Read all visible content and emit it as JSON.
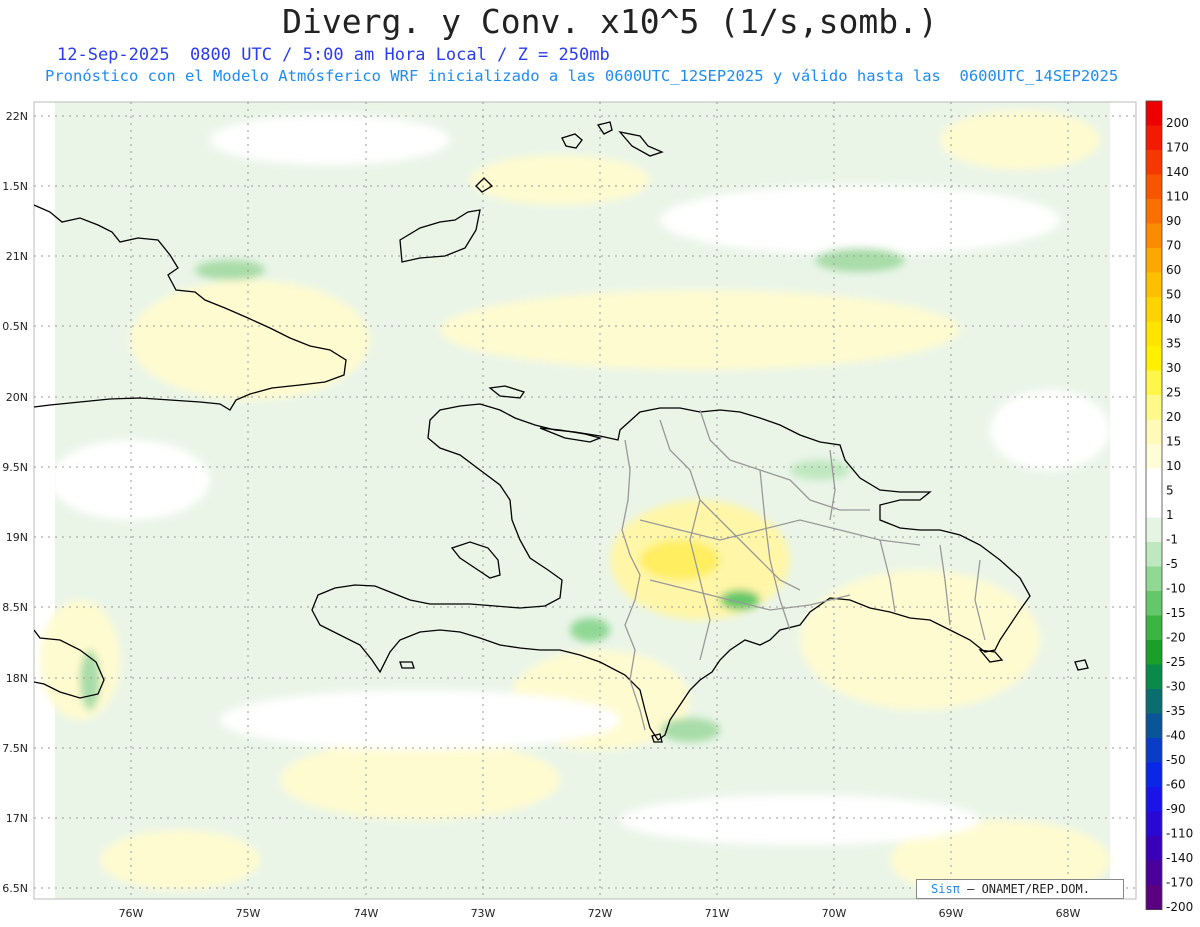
{
  "header": {
    "title": "Diverg. y Conv. x10^5 (1/s,somb.)",
    "subtitle": "12-Sep-2025  0800 UTC / 5:00 am Hora Local / Z = 250mb",
    "info": "Pronóstico con el Modelo Atmósferico WRF inicializado a las 0600UTC_12SEP2025 y válido hasta las  0600UTC_14SEP2025"
  },
  "map": {
    "lat_labels": [
      "22N",
      "1.5N",
      "21N",
      "0.5N",
      "20N",
      "9.5N",
      "19N",
      "8.5N",
      "18N",
      "7.5N",
      "17N",
      "6.5N"
    ],
    "lon_labels": [
      "76W",
      "75W",
      "74W",
      "73W",
      "72W",
      "71W",
      "70W",
      "69W",
      "68W"
    ]
  },
  "colorbar": {
    "labels": [
      "200",
      "170",
      "140",
      "110",
      "90",
      "70",
      "60",
      "50",
      "40",
      "35",
      "30",
      "25",
      "20",
      "15",
      "10",
      "5",
      "1",
      "-1",
      "-5",
      "-10",
      "-15",
      "-20",
      "-25",
      "-30",
      "-35",
      "-40",
      "-50",
      "-60",
      "-90",
      "-110",
      "-140",
      "-170",
      "-200"
    ],
    "colors": [
      "#ee0000",
      "#f21a00",
      "#f53800",
      "#f75500",
      "#f97000",
      "#fb8c00",
      "#fca800",
      "#fdc000",
      "#fed400",
      "#ffe400",
      "#fff000",
      "#fff64a",
      "#fff98a",
      "#fffab8",
      "#fffcd8",
      "#ffffff",
      "#ffffff",
      "#e6f4e4",
      "#bfe8c0",
      "#90d894",
      "#64c86a",
      "#3cb443",
      "#1aa02a",
      "#0a8a4a",
      "#0a6e6e",
      "#0a5498",
      "#0a3cc8",
      "#0a26e6",
      "#1a14e8",
      "#2a08d4",
      "#3a00b8",
      "#4a009a",
      "#5a0080"
    ]
  },
  "credit": {
    "brand": "Sisπ",
    "org": " – ONAMET/REP.DOM."
  }
}
